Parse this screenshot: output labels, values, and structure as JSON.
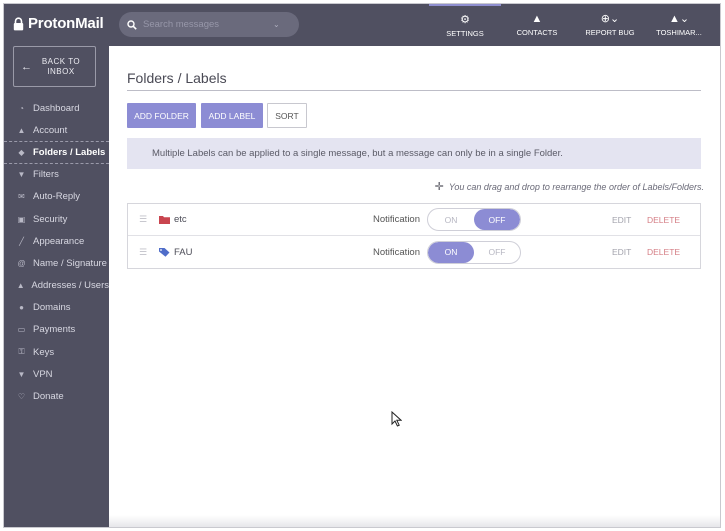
{
  "app": {
    "logo_text": "ProtonMail",
    "accent_color": "#8c8cd4",
    "sidebar_color": "#505061"
  },
  "sidebar": {
    "back_label": "BACK TO INBOX",
    "items": [
      {
        "label": "Dashboard",
        "icon": "dashboard-icon"
      },
      {
        "label": "Account",
        "icon": "user-icon"
      },
      {
        "label": "Folders / Labels",
        "icon": "tag-icon",
        "active": true
      },
      {
        "label": "Filters",
        "icon": "filter-icon"
      },
      {
        "label": "Auto-Reply",
        "icon": "envelope-icon"
      },
      {
        "label": "Security",
        "icon": "lock-icon"
      },
      {
        "label": "Appearance",
        "icon": "paintbrush-icon"
      },
      {
        "label": "Name / Signature",
        "icon": "at-icon"
      },
      {
        "label": "Addresses / Users",
        "icon": "users-icon"
      },
      {
        "label": "Domains",
        "icon": "globe-icon"
      },
      {
        "label": "Payments",
        "icon": "credit-card-icon"
      },
      {
        "label": "Keys",
        "icon": "key-icon"
      },
      {
        "label": "VPN",
        "icon": "shield-icon"
      },
      {
        "label": "Donate",
        "icon": "heart-icon"
      }
    ]
  },
  "topbar": {
    "search_placeholder": "Search messages",
    "settings_label": "SETTINGS",
    "contacts_label": "CONTACTS",
    "report_bug_label": "REPORT BUG",
    "user_label": "TOSHIMAR..."
  },
  "main": {
    "title": "Folders / Labels",
    "add_folder_label": "ADD FOLDER",
    "add_label_label": "ADD LABEL",
    "sort_label": "SORT",
    "info_text": "Multiple Labels can be applied to a single message, but a message can only be in a single Folder.",
    "drag_hint": "You can drag and drop to rearrange the order of Labels/Folders.",
    "notification_label": "Notification",
    "toggle_on": "ON",
    "toggle_off": "OFF",
    "edit_label": "EDIT",
    "delete_label": "DELETE",
    "rows": [
      {
        "name": "etc",
        "type": "folder",
        "color": "#c9454f",
        "notification": "off"
      },
      {
        "name": "FAU",
        "type": "label",
        "color": "#4f6dc9",
        "notification": "on"
      }
    ]
  }
}
